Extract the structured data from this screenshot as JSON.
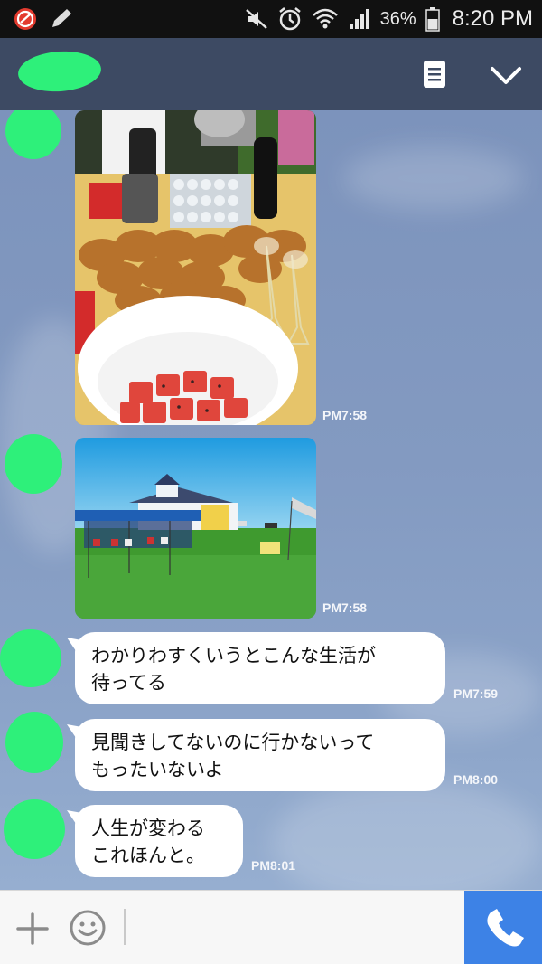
{
  "status_bar": {
    "battery_percent": "36%",
    "time": "8:20 PM",
    "icons": [
      "app-red-icon",
      "pencil-icon",
      "mute-icon",
      "alarm-icon",
      "wifi-icon",
      "signal-icon",
      "battery-icon"
    ]
  },
  "header": {
    "icons": [
      "menu-icon",
      "chevron-down-icon"
    ]
  },
  "messages": [
    {
      "type": "image",
      "subject": "party food table",
      "time": "PM7:58"
    },
    {
      "type": "image",
      "subject": "house and tents on lawn",
      "time": "PM7:58"
    },
    {
      "type": "text",
      "lines": [
        "わかりわすくいうとこんな生活が",
        "待ってる"
      ],
      "time": "PM7:59"
    },
    {
      "type": "text",
      "lines": [
        "見聞きしてないのに行かないって",
        "もったいないよ"
      ],
      "time": "PM8:00"
    },
    {
      "type": "text",
      "lines": [
        "人生が変わる",
        "これほんと。"
      ],
      "time": "PM8:01"
    }
  ],
  "input_bar": {
    "icons": [
      "plus-icon",
      "emoji-icon",
      "phone-icon"
    ],
    "call_button_color": "#3d82e6"
  },
  "colors": {
    "header_bg": "#3d4a63",
    "chat_bg": "#7d95bd",
    "redaction_green": "#2ef07a"
  }
}
